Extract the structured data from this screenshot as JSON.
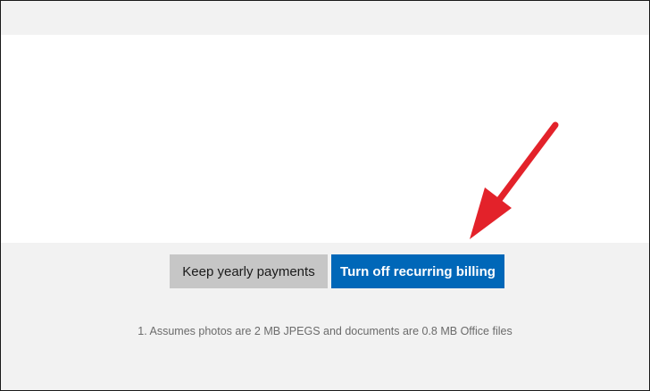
{
  "dialog": {
    "keep_button_label": "Keep yearly payments",
    "turn_off_button_label": "Turn off recurring billing",
    "footnote": "1. Assumes photos are 2 MB JPEGS and documents are 0.8 MB Office files"
  },
  "colors": {
    "primary_button": "#0067b8",
    "secondary_button": "#c6c6c6",
    "annotation_arrow": "#e3222a"
  },
  "annotation": {
    "icon": "red-arrow-icon"
  }
}
